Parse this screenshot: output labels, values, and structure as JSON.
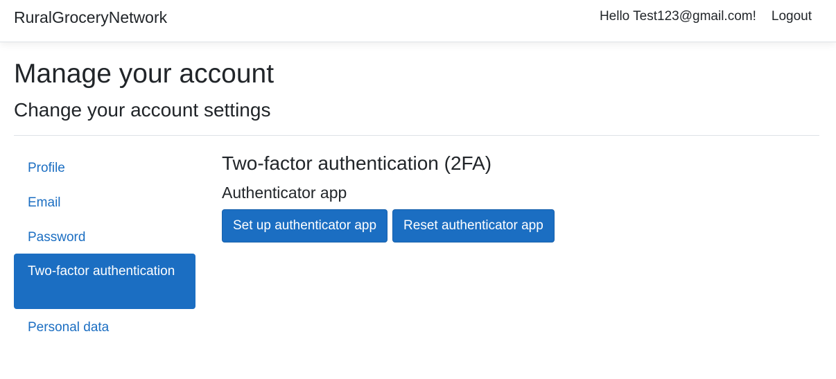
{
  "navbar": {
    "brand": "RuralGroceryNetwork",
    "greeting": "Hello Test123@gmail.com!",
    "logout": "Logout"
  },
  "header": {
    "title": "Manage your account",
    "subtitle": "Change your account settings"
  },
  "sidebar": {
    "items": [
      {
        "label": "Profile"
      },
      {
        "label": "Email"
      },
      {
        "label": "Password"
      },
      {
        "label": "Two-factor authentication",
        "active": true
      },
      {
        "label": "Personal data"
      }
    ]
  },
  "main": {
    "heading": "Two-factor authentication (2FA)",
    "subheading": "Authenticator app",
    "buttons": {
      "setup": "Set up authenticator app",
      "reset": "Reset authenticator app"
    }
  },
  "colors": {
    "primary": "#1b6ec2",
    "text": "#212529",
    "border": "#dee2e6"
  }
}
